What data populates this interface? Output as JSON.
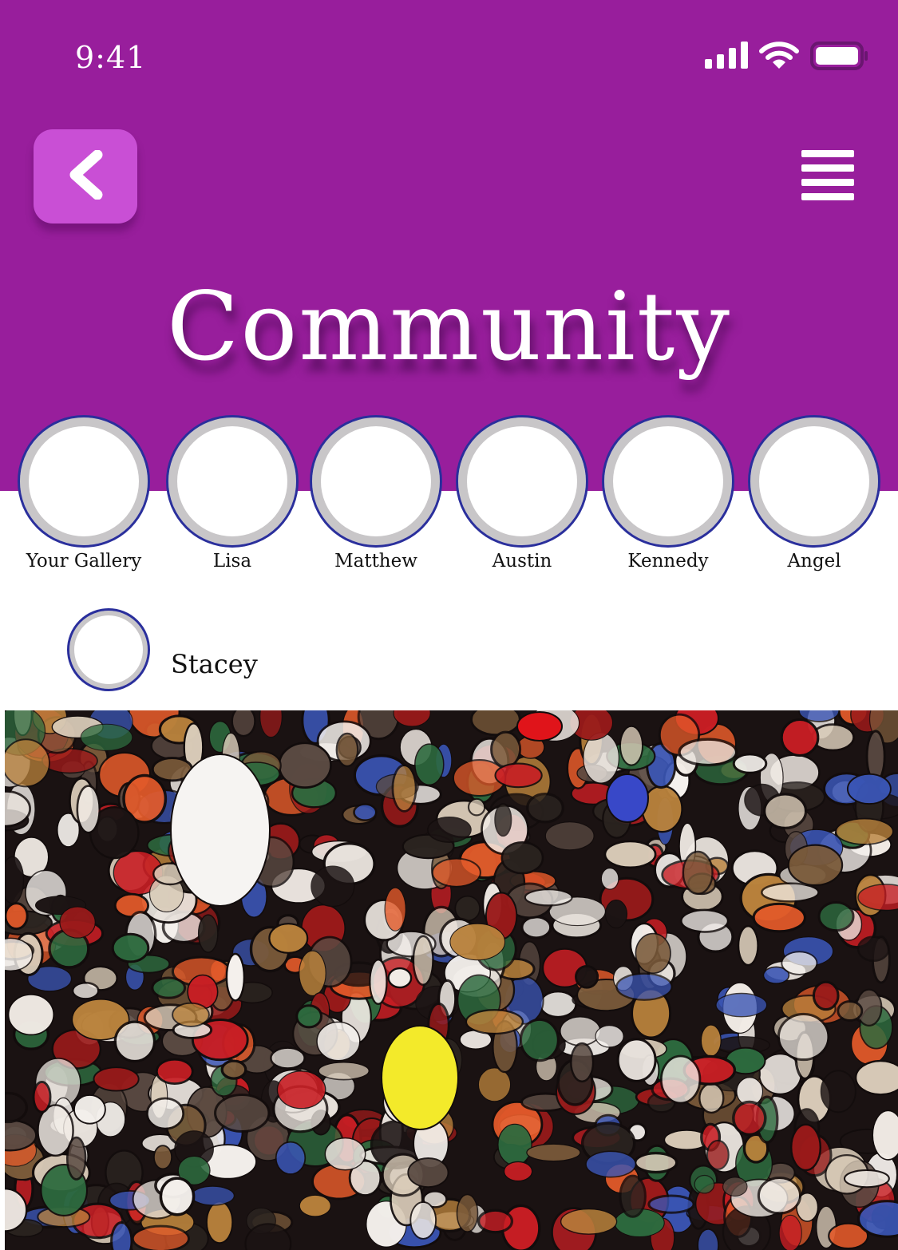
{
  "status_bar": {
    "time": "9:41",
    "icons": [
      "signal-icon",
      "wifi-icon",
      "battery-icon"
    ]
  },
  "header": {
    "back_icon": "chevron-left-icon",
    "menu_icon": "hamburger-menu-icon",
    "title": "Community"
  },
  "stories": [
    {
      "label": "Your Gallery"
    },
    {
      "label": "Lisa"
    },
    {
      "label": "Matthew"
    },
    {
      "label": "Austin"
    },
    {
      "label": "Kennedy"
    },
    {
      "label": "Angel"
    }
  ],
  "post": {
    "author": "Stacey"
  },
  "colors": {
    "header_bg": "#981e9c",
    "back_button_bg": "#c94fd5",
    "avatar_border": "#2a2f9c",
    "avatar_ring": "#c8c6c8"
  }
}
